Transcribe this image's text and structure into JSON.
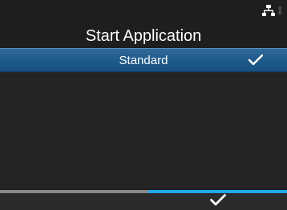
{
  "header": {
    "title": "Start Application"
  },
  "status": {
    "network_icon": "network-icon",
    "bluetooth_icon": "bluetooth-icon"
  },
  "list": {
    "items": [
      {
        "label": "Standard",
        "selected": true,
        "checked": true
      }
    ]
  },
  "softkeys": {
    "left": {
      "icon": "none"
    },
    "right": {
      "icon": "checkmark-icon"
    }
  },
  "colors": {
    "background": "#1e1e1e",
    "selection": "#1f5a8c",
    "softkey_left_accent": "#8a8a8a",
    "softkey_right_accent": "#1ea8e8"
  }
}
